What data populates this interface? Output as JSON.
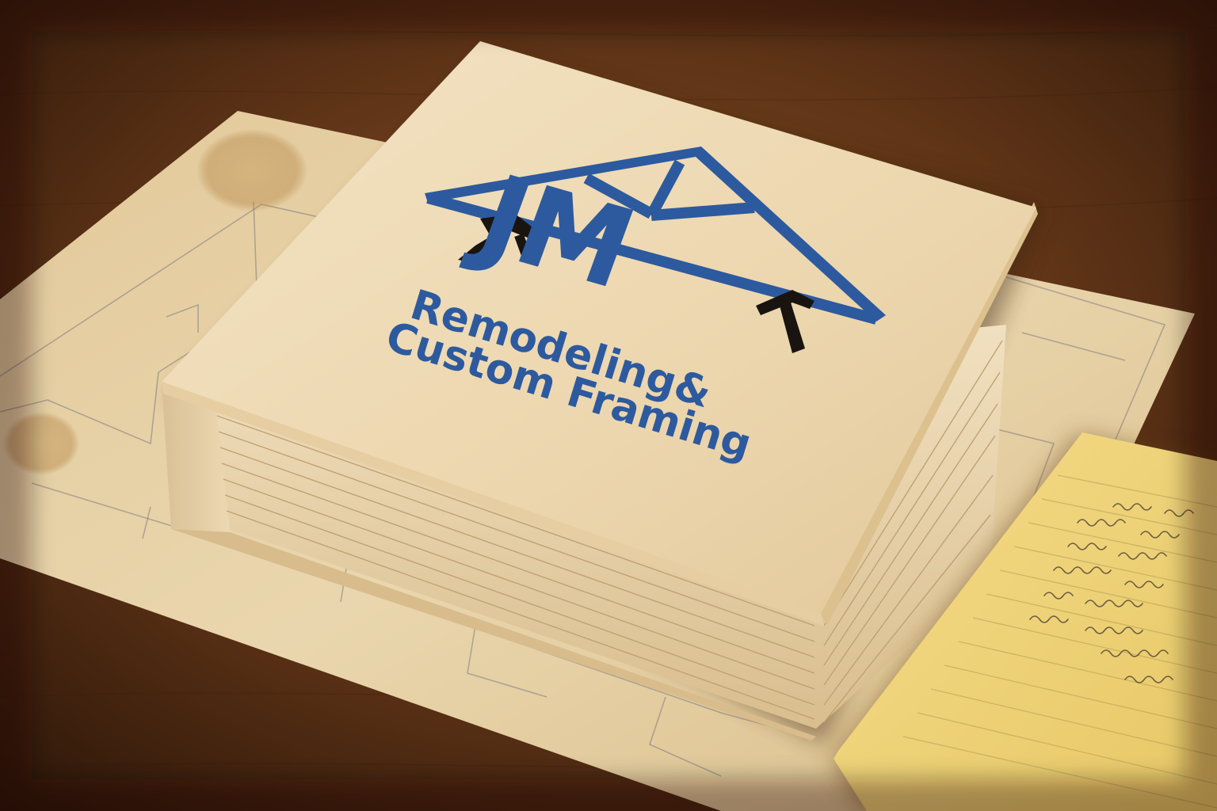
{
  "logo": {
    "monogram": "JM",
    "line1": "Remodeling&",
    "line2": "Custom Framing",
    "color": "#2d5a9e",
    "icon_names": [
      "roof-truss-icon",
      "nail-gun-icon",
      "hammer-icon"
    ]
  },
  "palette": {
    "table_dark": "#2a1508",
    "table_mid": "#7a4a22",
    "blueprint_paper": "#e9d4a8",
    "binder_cover": "#efdcb8",
    "notepad": "#f0d47a",
    "logo_blue": "#2d5a9e"
  }
}
